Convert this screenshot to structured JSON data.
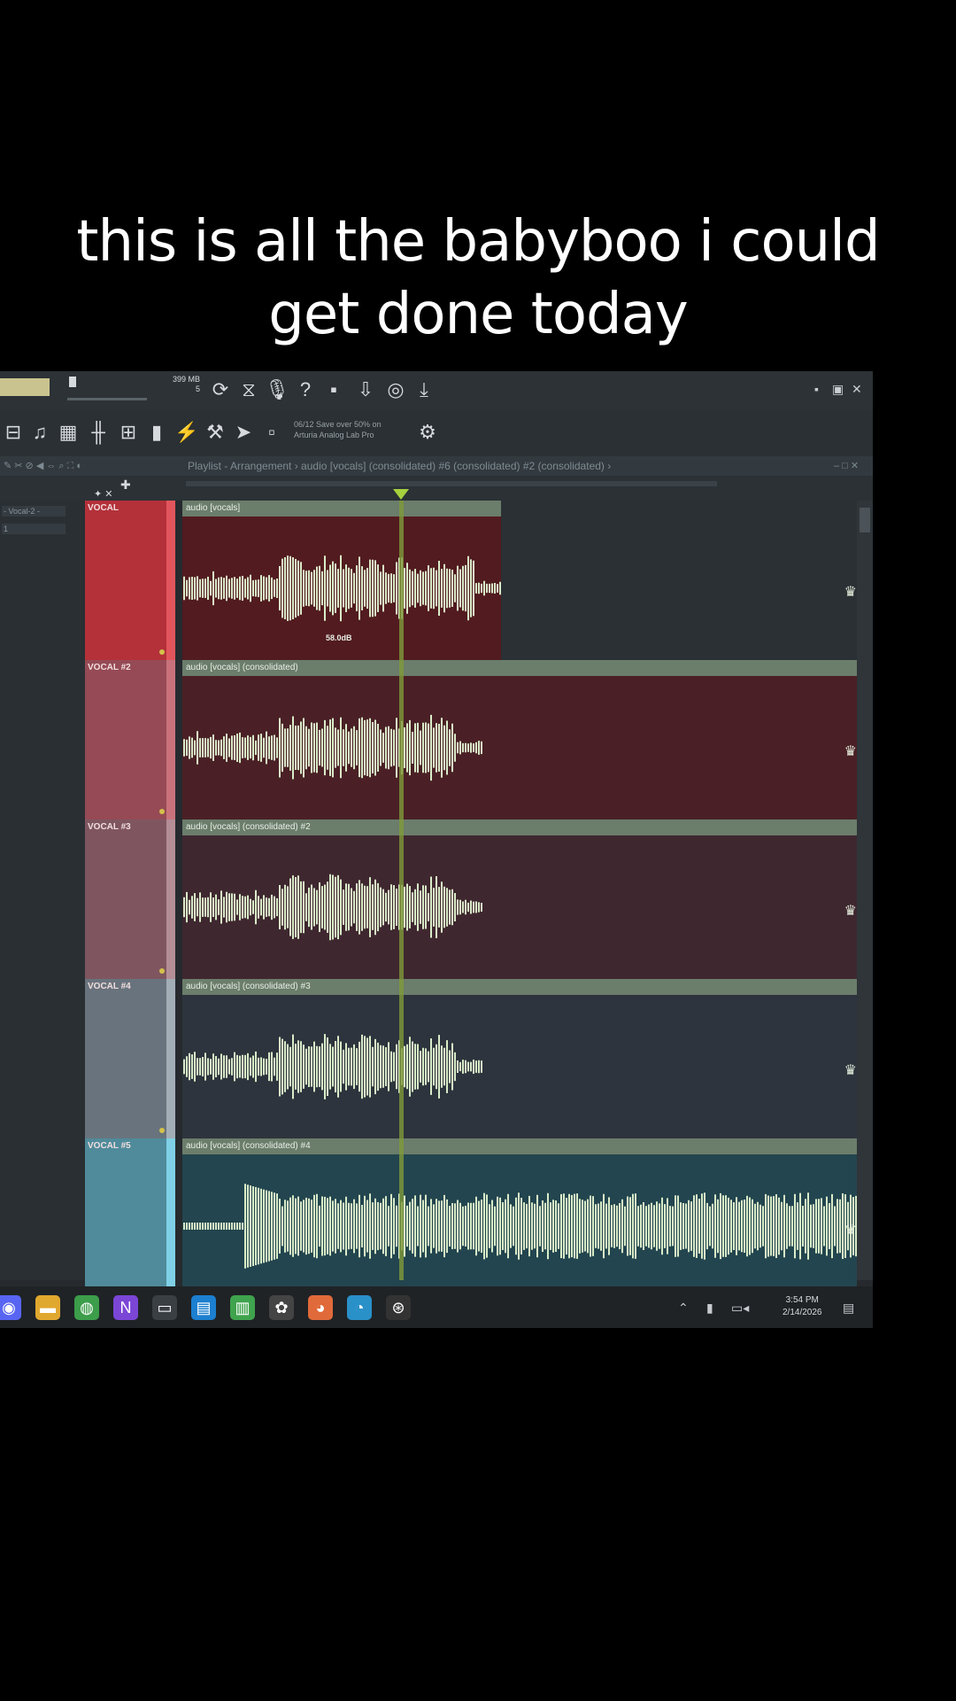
{
  "caption": {
    "line1": "this is all the babyboo i could",
    "line2": "get done today"
  },
  "toolbar": {
    "promo_line1": "06/12 Save over 50% on",
    "promo_line2": "Arturia Analog Lab Pro",
    "cpu_label": "399 MB",
    "cpu_value": "5"
  },
  "playlist_title": "Playlist - Arrangement › audio [vocals] (consolidated) #6 (consolidated) #2 (consolidated) ›",
  "sidebar": {
    "pattern": "- Vocal-2 -",
    "item": "1"
  },
  "tracks": [
    {
      "name": "VOCAL",
      "clip": "audio [vocals]",
      "db_label": "58.0dB",
      "head_color": "#b4313a",
      "bar_color": "#e2555c",
      "lane_color": "#521b20",
      "empty_color": "#2a3034"
    },
    {
      "name": "VOCAL #2",
      "clip": "audio [vocals] (consolidated)",
      "head_color": "#964a55",
      "bar_color": "#c9727c",
      "lane_color": "#4a2026",
      "empty_color": "#4a2026"
    },
    {
      "name": "VOCAL #3",
      "clip": "audio [vocals] (consolidated) #2",
      "head_color": "#7f5660",
      "bar_color": "#b48d96",
      "lane_color": "#3f2730",
      "empty_color": "#3f2730"
    },
    {
      "name": "VOCAL #4",
      "clip": "audio [vocals] (consolidated) #3",
      "head_color": "#69737d",
      "bar_color": "#a3adb6",
      "lane_color": "#2d343d",
      "empty_color": "#2d343d"
    },
    {
      "name": "VOCAL #5",
      "clip": "audio [vocals] (consolidated) #4",
      "head_color": "#4f8b9b",
      "bar_color": "#7fd0e6",
      "lane_color": "#23454f",
      "empty_color": "#23454f"
    }
  ],
  "taskbar": {
    "icons": [
      "discord-icon",
      "folder-icon",
      "chrome-icon",
      "visual-studio-icon",
      "terminal-icon",
      "notepad-icon",
      "notes-icon",
      "fl-studio-icon",
      "paint-icon",
      "edge-icon",
      "steam-icon"
    ],
    "time": "3:54 PM",
    "date": "2/14/2026"
  },
  "colors": {
    "waveform": "#d9ecc8",
    "playhead": "#a6d03e",
    "clip_header": "#6b7d6b"
  }
}
